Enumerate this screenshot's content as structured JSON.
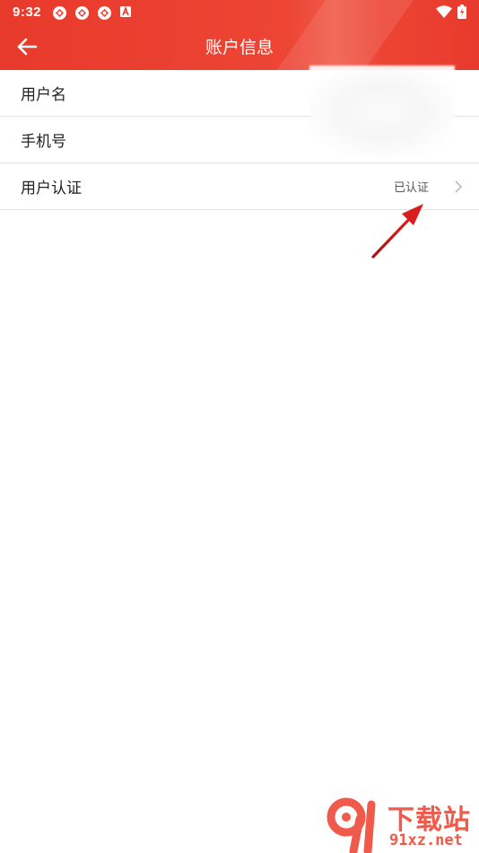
{
  "status_bar": {
    "time": "9:32",
    "icons": [
      "app-notification-icon",
      "app-notification-icon",
      "app-notification-icon",
      "a-icon"
    ],
    "right_icons": [
      "wifi-icon",
      "battery-icon"
    ]
  },
  "header": {
    "title": "账户信息",
    "back_icon": "back-arrow-icon",
    "color": "#e83a2c"
  },
  "rows": [
    {
      "label": "用户名",
      "value": ""
    },
    {
      "label": "手机号",
      "value": ""
    },
    {
      "label": "用户认证",
      "value": "已认证"
    }
  ],
  "annotation": {
    "color": "#d81e1e"
  },
  "watermark": {
    "text": "下载站",
    "url": "91xz.net",
    "color": "#ef5a4a"
  }
}
